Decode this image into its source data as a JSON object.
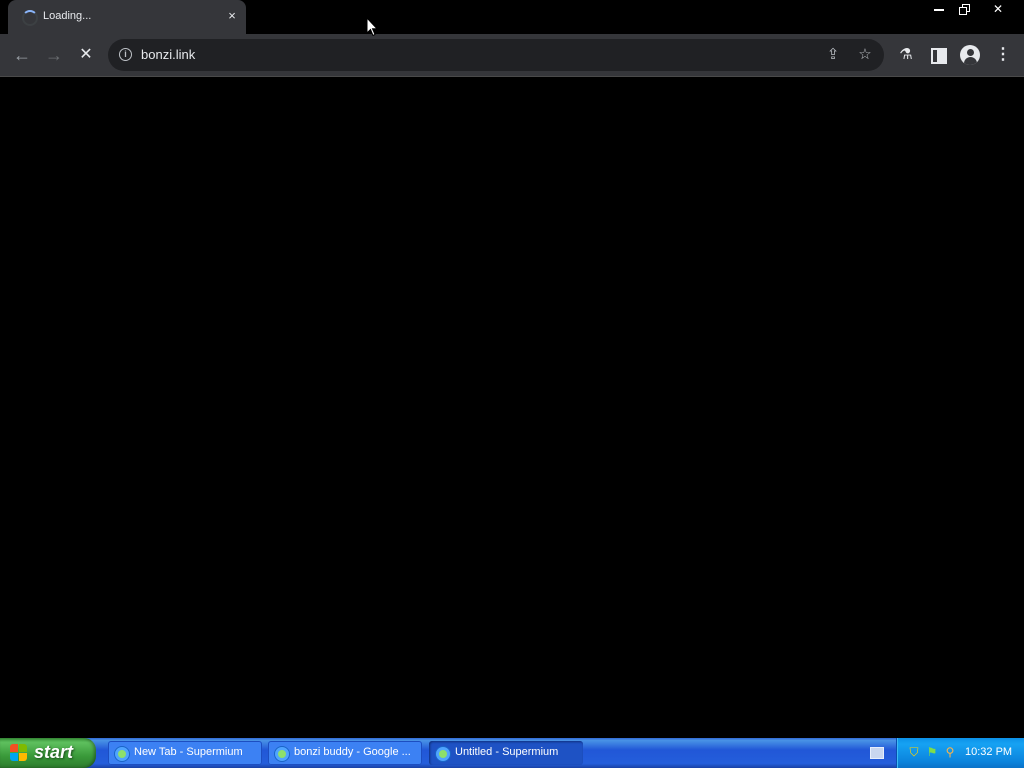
{
  "window": {
    "tab_title": "Loading...",
    "tab_close": "×",
    "minimize": "minimize",
    "restore": "restore",
    "close": "✕"
  },
  "toolbar": {
    "back": "←",
    "forward": "→",
    "stop": "✕",
    "url": "bonzi.link",
    "info": "i",
    "share": "⇪",
    "star": "☆",
    "labs": "⚗",
    "menu": "⋮"
  },
  "taskbar": {
    "start_label": "start",
    "tasks": [
      {
        "label": "New Tab - Supermium"
      },
      {
        "label": "bonzi buddy - Google ..."
      },
      {
        "label": "Untitled - Supermium"
      }
    ],
    "clock": "10:32 PM"
  },
  "colors": {
    "accent_tab": "#35363a",
    "taskbar": "#245edb",
    "start": "#3a9a3a",
    "tray": "#0b83dc"
  }
}
